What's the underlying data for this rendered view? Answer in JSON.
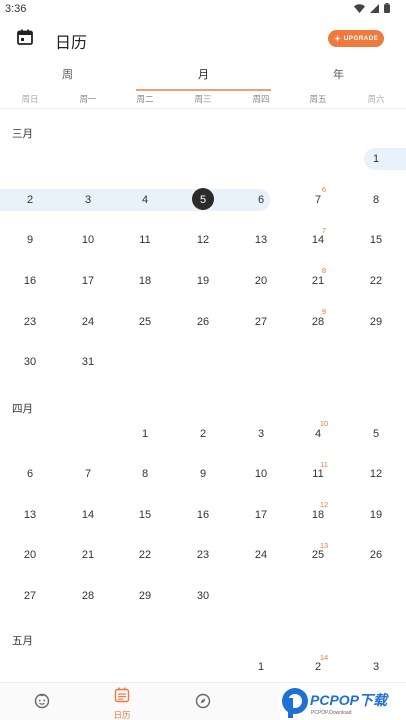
{
  "status": {
    "time": "3:36"
  },
  "appbar": {
    "title": "日历",
    "upgrade_label": "UPGRADE"
  },
  "tabs": [
    {
      "label": "周"
    },
    {
      "label": "月"
    },
    {
      "label": "年"
    }
  ],
  "weekdays": [
    "周日",
    "周一",
    "周二",
    "周三",
    "周四",
    "周五",
    "周六"
  ],
  "months": {
    "march": {
      "label": "三月"
    },
    "april": {
      "label": "四月"
    },
    "may": {
      "label": "五月"
    }
  },
  "days": {
    "mar": [
      "1",
      "2",
      "3",
      "4",
      "5",
      "6",
      "7",
      "8",
      "9",
      "10",
      "11",
      "12",
      "13",
      "14",
      "15",
      "16",
      "17",
      "18",
      "19",
      "20",
      "21",
      "22",
      "23",
      "24",
      "25",
      "26",
      "27",
      "28",
      "29",
      "30",
      "31"
    ],
    "apr": [
      "1",
      "2",
      "3",
      "4",
      "5",
      "6",
      "7",
      "8",
      "9",
      "10",
      "11",
      "12",
      "13",
      "14",
      "15",
      "16",
      "17",
      "18",
      "19",
      "20",
      "21",
      "22",
      "23",
      "24",
      "25",
      "26",
      "27",
      "28",
      "29",
      "30"
    ],
    "may": [
      "1",
      "2",
      "3"
    ]
  },
  "week_numbers": [
    "6",
    "7",
    "8",
    "9",
    "10",
    "11",
    "12",
    "13",
    "14"
  ],
  "bottom_nav": {
    "calendar_label": "日历"
  },
  "watermark": {
    "brand": "PCPOP下载",
    "sub": "PCPOP.Download"
  },
  "colors": {
    "accent": "#f07a3c",
    "highlight": "#e9f1fa",
    "today": "#2b2b2b"
  }
}
